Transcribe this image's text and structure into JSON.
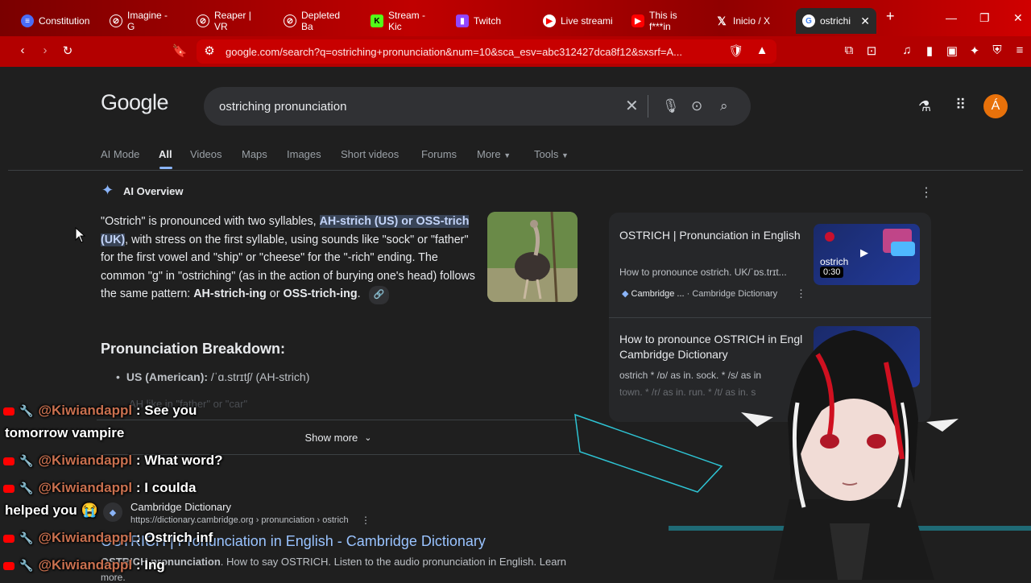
{
  "browser": {
    "tabs": [
      {
        "label": "Constitution",
        "icon": "doc-icon",
        "color": "#4a6cf7"
      },
      {
        "label": "Imagine - G",
        "icon": "grok-icon",
        "color": "#333333"
      },
      {
        "label": "Reaper | VR",
        "icon": "grok-icon",
        "color": "#333333"
      },
      {
        "label": "Depleted Ba",
        "icon": "grok-icon",
        "color": "#333333"
      },
      {
        "label": "Stream - Kic",
        "icon": "kick-icon",
        "color": "#53fc18"
      },
      {
        "label": "Twitch",
        "icon": "twitch-icon",
        "color": "#9146ff"
      },
      {
        "label": "Live streami",
        "icon": "youtube-icon",
        "color": "#ff0000"
      },
      {
        "label": "This is f***in",
        "icon": "youtube-icon",
        "color": "#ff0000"
      },
      {
        "label": "Inicio / X",
        "icon": "x-icon",
        "color": "#000000"
      },
      {
        "label": "ostrichi",
        "icon": "google-icon",
        "color": "#4285f4"
      }
    ],
    "url": "google.com/search?q=ostriching+pronunciation&num=10&sca_esv=abc312427dca8f12&sxsrf=A..."
  },
  "google": {
    "logo": "Google",
    "query": "ostriching pronunciation",
    "avatar_letter": "Á",
    "nav_tabs": [
      "AI Mode",
      "All",
      "Videos",
      "Maps",
      "Images",
      "Short videos",
      "Forums",
      "More",
      "Tools"
    ],
    "active_tab": "All"
  },
  "ai_overview": {
    "title": "AI Overview",
    "p1": "\"Ostrich\" is pronounced with two syllables, ",
    "highlight": "AH-strich (US) or OSS-trich (UK)",
    "p2": ", with stress on the first syllable, using sounds like \"sock\" or \"father\" for the first vowel and \"ship\" or \"cheese\" for the \"-rich\" ending. The common \"g\" in \"ostriching\" (as in the action of burying one's head) follows the same pattern: ",
    "bold1": "AH-strich-ing",
    "p3": " or ",
    "bold2": "OSS-trich-ing",
    "p4": ".",
    "breakdown_title": "Pronunciation Breakdown:",
    "us_label": "US (American):",
    "us_value": " /ˈɑ.strɪtʃ/ (AH-strich)",
    "faded_line": "AH like in \"father\" or \"car\"",
    "show_more": "Show more"
  },
  "side": {
    "card1_title": "OSTRICH | Pronunciation in English",
    "card1_desc": "How to pronounce ostrich. UK/ˈɒs.trɪt...",
    "card1_source": "Cambridge ...",
    "card1_source2": "· Cambridge Dictionary",
    "thumb_word": "ostrich",
    "duration": "0:30",
    "card2_title": "How to pronounce OSTRICH in Engl",
    "card2_title2": "Cambridge Dictionary",
    "card2_desc": "ostrich * /ɒ/ as in. sock. * /s/ as in",
    "card2_desc2": "town. * /r/ as in. run. * /t/ as in. s"
  },
  "result": {
    "site": "Cambridge Dictionary",
    "url": "https://dictionary.cambridge.org › pronunciation › ostrich",
    "title": "OSTRICH | Pronunciation in English - Cambridge Dictionary",
    "snippet_bold": "OSTRICH pronunciation",
    "snippet": ". How to say OSTRICH. Listen to the audio pronunciation in English. Learn",
    "more": "more."
  },
  "chat": [
    {
      "user": "@Kiwiandappl",
      "msg": " : See you"
    },
    {
      "cont": "tomorrow vampire"
    },
    {
      "user": "@Kiwiandappl",
      "msg": " : What word?"
    },
    {
      "user": "@Kiwiandappl",
      "msg": " : I coulda"
    },
    {
      "cont": "helped you 😭"
    },
    {
      "user": "@Kiwiandappl",
      "msg": " : Ostrich inf"
    },
    {
      "user": "@Kiwiandappl",
      "msg": " : Ing"
    }
  ]
}
